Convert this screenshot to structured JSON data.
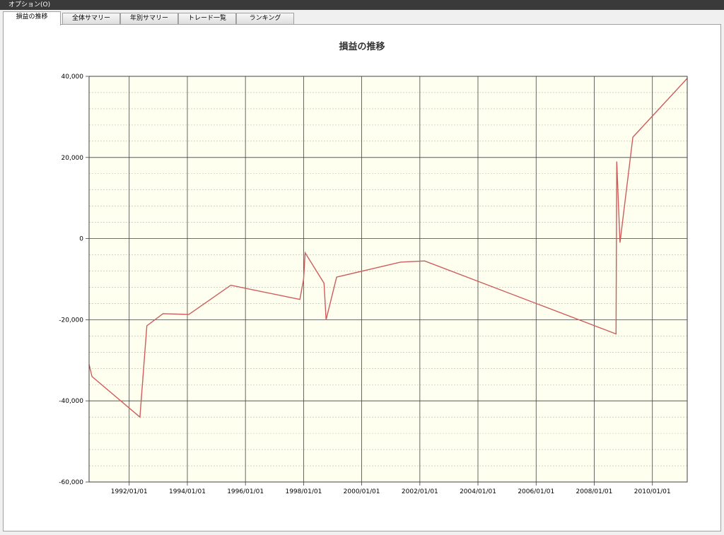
{
  "menu": {
    "options_label": "オプション(O)"
  },
  "tabs": [
    {
      "label": "損益の推移",
      "active": true
    },
    {
      "label": "全体サマリー",
      "active": false
    },
    {
      "label": "年別サマリー",
      "active": false
    },
    {
      "label": "トレード一覧",
      "active": false
    },
    {
      "label": "ランキング",
      "active": false
    }
  ],
  "chart_data": {
    "type": "line",
    "title": "損益の推移",
    "xlabel": "",
    "ylabel": "",
    "x_axis_type": "date",
    "xlim": [
      "1990/08/15",
      "2011/03/15"
    ],
    "ylim": [
      -60000,
      40000
    ],
    "y_major_step": 20000,
    "y_minor_step": 4000,
    "x_ticks": [
      "1992/01/01",
      "1994/01/01",
      "1996/01/01",
      "1998/01/01",
      "2000/01/01",
      "2002/01/01",
      "2004/01/01",
      "2006/01/01",
      "2008/01/01",
      "2010/01/01"
    ],
    "y_ticks": [
      "-60,000",
      "-40,000",
      "-20,000",
      "0",
      "20,000",
      "40,000"
    ],
    "grid": true,
    "background_color": "#fffff0",
    "line_color": "#cd5c5c",
    "series": [
      {
        "x": [
          "1990/08/15",
          "1990/09/20",
          "1992/05/15",
          "1992/08/10",
          "1993/03/01",
          "1994/01/20",
          "1995/07/01",
          "1997/11/15",
          "1998/01/01",
          "1998/01/20",
          "1998/09/15",
          "1998/10/10",
          "1999/02/20",
          "2001/05/01",
          "2002/03/01",
          "2008/10/01",
          "2008/10/10",
          "2008/11/20",
          "2009/05/01",
          "2011/03/15"
        ],
        "y": [
          -31000,
          -34000,
          -44000,
          -21500,
          -18500,
          -18700,
          -11500,
          -15000,
          -10000,
          -3500,
          -11000,
          -20000,
          -9500,
          -5800,
          -5500,
          -23500,
          19000,
          -1000,
          25000,
          39500
        ]
      }
    ]
  }
}
